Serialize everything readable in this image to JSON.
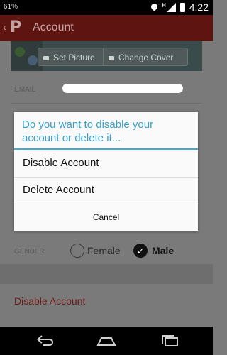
{
  "status_bar": {
    "battery_text": "61%",
    "time": "4:22",
    "network_letter": "H"
  },
  "action_bar": {
    "title": "Account",
    "logo_letter": "P"
  },
  "cover": {
    "set_picture_label": "Set Picture",
    "change_cover_label": "Change Cover"
  },
  "form": {
    "email_label": "EMAIL",
    "gender_label": "GENDER",
    "female_label": "Female",
    "male_label": "Male",
    "selected_gender": "Male"
  },
  "disable_link": "Disable Account",
  "dialog": {
    "title": "Do you want to disable your account or delete it...",
    "options": [
      "Disable Account",
      "Delete Account"
    ],
    "cancel_label": "Cancel"
  },
  "colors": {
    "accent": "#3aa0c9",
    "brand": "#5e1512"
  }
}
